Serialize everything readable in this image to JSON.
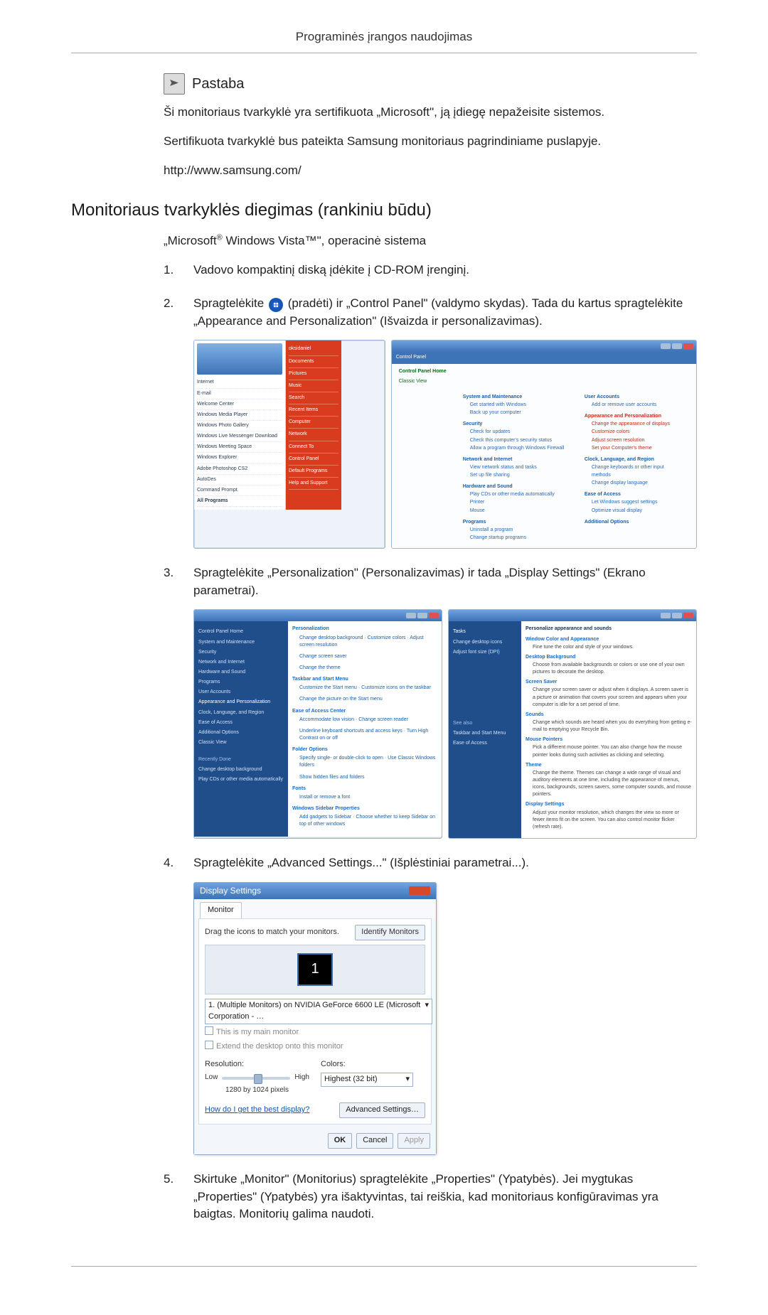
{
  "header": {
    "title": "Programinės įrangos naudojimas"
  },
  "note": {
    "icon_name": "note-icon",
    "title": "Pastaba",
    "lines": [
      "Ši monitoriaus tvarkyklė yra sertifikuota „Microsoft\", ją įdiegę nepažeisite sistemos.",
      "Sertifikuota tvarkyklė bus pateikta Samsung monitoriaus pagrindiniame puslapyje.",
      "http://www.samsung.com/"
    ]
  },
  "section": {
    "heading": "Monitoriaus tvarkyklės diegimas (rankiniu būdu)",
    "os_line_pre": "„Microsoft",
    "os_reg": "®",
    "os_line_post": " Windows Vista™\", operacinė sistema"
  },
  "steps": [
    {
      "text": "Vadovo kompaktinį diską įdėkite į CD-ROM įrenginį."
    },
    {
      "pre": "Spragtelėkite ",
      "icon_name": "start-icon",
      "post": "(pradėti) ir „Control Panel\" (valdymo skydas). Tada du kartus spragtelėkite „Appearance and Personalization\" (Išvaizda ir personalizavimas)."
    },
    {
      "text": "Spragtelėkite „Personalization\" (Personalizavimas) ir tada „Display Settings\" (Ekrano parametrai)."
    },
    {
      "text": "Spragtelėkite „Advanced Settings...\" (Išplėstiniai parametrai...)."
    },
    {
      "text": "Skirtuke „Monitor\" (Monitorius) spragtelėkite „Properties\" (Ypatybės). Jei mygtukas „Properties\" (Ypatybės) yra išaktyvintas, tai reiškia, kad monitoriaus konfigūravimas yra baigtas. Monitorių galima naudoti."
    }
  ],
  "shot_start": {
    "sidebar": [
      "Internet",
      "E-mail",
      "Welcome Center",
      "Windows Media Player",
      "Windows Photo Gallery",
      "Windows Live Messenger Download",
      "Windows Meeting Space",
      "Windows Explorer",
      "Adobe Photoshop CS2",
      "AutoDes",
      "Command Prompt"
    ],
    "sidebar_bottom": "All Programs",
    "right": [
      "oksidaniel",
      "Documents",
      "Pictures",
      "Music",
      "Search",
      "Recent Items",
      "Computer",
      "Network",
      "Connect To",
      "Control Panel",
      "Default Programs",
      "Help and Support"
    ]
  },
  "shot_cp": {
    "breadcrumb": "Control Panel",
    "home": "Control Panel Home",
    "classic": "Classic View",
    "left": [
      {
        "t": "System and Maintenance",
        "s": [
          "Get started with Windows",
          "Back up your computer"
        ]
      },
      {
        "t": "Security",
        "s": [
          "Check for updates",
          "Check this computer's security status",
          "Allow a program through Windows Firewall"
        ]
      },
      {
        "t": "Network and Internet",
        "s": [
          "View network status and tasks",
          "Set up file sharing"
        ]
      },
      {
        "t": "Hardware and Sound",
        "s": [
          "Play CDs or other media automatically",
          "Printer",
          "Mouse"
        ]
      },
      {
        "t": "Programs",
        "s": [
          "Uninstall a program",
          "Change startup programs"
        ]
      }
    ],
    "right": [
      {
        "t": "User Accounts",
        "s": [
          "Add or remove user accounts"
        ]
      },
      {
        "t": "Appearance and Personalization",
        "s": [
          "Change the appearance of displays",
          "Customize colors",
          "Adjust screen resolution",
          "Set your Computer's theme"
        ]
      },
      {
        "t": "Clock, Language, and Region",
        "s": [
          "Change keyboards or other input",
          "methods",
          "Change display language"
        ]
      },
      {
        "t": "Ease of Access",
        "s": [
          "Let Windows suggest settings",
          "Optimize visual display"
        ]
      },
      {
        "t": "Additional Options",
        "s": []
      }
    ]
  },
  "shot_perso_a": {
    "side": [
      "Control Panel Home",
      "System and Maintenance",
      "Security",
      "Network and Internet",
      "Hardware and Sound",
      "Programs",
      "User Accounts",
      "Appearance and Personalization",
      "Clock, Language, and Region",
      "Ease of Access",
      "Additional Options",
      "Classic View"
    ],
    "side_bottom": [
      "Recently Done",
      "Change desktop background",
      "Play CDs or other media automatically"
    ],
    "main": [
      {
        "t": "Personalization",
        "s": [
          "Change desktop background · Customize colors · Adjust screen resolution",
          "Change screen saver",
          "Change the theme"
        ]
      },
      {
        "t": "Taskbar and Start Menu",
        "s": [
          "Customize the Start menu · Customize icons on the taskbar",
          "Change the picture on the Start menu"
        ]
      },
      {
        "t": "Ease of Access Center",
        "s": [
          "Accommodate low vision · Change screen reader",
          "Underline keyboard shortcuts and access keys · Turn High Contrast on or off"
        ]
      },
      {
        "t": "Folder Options",
        "s": [
          "Specify single- or double-click to open · Use Classic Windows folders",
          "Show hidden files and folders"
        ]
      },
      {
        "t": "Fonts",
        "s": [
          "Install or remove a font"
        ]
      },
      {
        "t": "Windows Sidebar Properties",
        "s": [
          "Add gadgets to Sidebar · Choose whether to keep Sidebar on top of other windows"
        ]
      }
    ]
  },
  "shot_perso_b": {
    "side": [
      "Tasks",
      "Change desktop icons",
      "Adjust font size (DPI)"
    ],
    "title": "Personalize appearance and sounds",
    "main": [
      {
        "t": "Window Color and Appearance",
        "d": "Fine tune the color and style of your windows."
      },
      {
        "t": "Desktop Background",
        "d": "Choose from available backgrounds or colors or use one of your own pictures to decorate the desktop."
      },
      {
        "t": "Screen Saver",
        "d": "Change your screen saver or adjust when it displays. A screen saver is a picture or animation that covers your screen and appears when your computer is idle for a set period of time."
      },
      {
        "t": "Sounds",
        "d": "Change which sounds are heard when you do everything from getting e-mail to emptying your Recycle Bin."
      },
      {
        "t": "Mouse Pointers",
        "d": "Pick a different mouse pointer. You can also change how the mouse pointer looks during such activities as clicking and selecting."
      },
      {
        "t": "Theme",
        "d": "Change the theme. Themes can change a wide range of visual and auditory elements at one time, including the appearance of menus, icons, backgrounds, screen savers, some computer sounds, and mouse pointers."
      },
      {
        "t": "Display Settings",
        "d": "Adjust your monitor resolution, which changes the view so more or fewer items fit on the screen. You can also control monitor flicker (refresh rate)."
      }
    ],
    "bottom": [
      "See also",
      "Taskbar and Start Menu",
      "Ease of Access"
    ]
  },
  "dlg": {
    "title": "Display Settings",
    "tab": "Monitor",
    "drag": "Drag the icons to match your monitors.",
    "identify": "Identify Monitors",
    "mon_label": "1",
    "mon_sel": "1. (Multiple Monitors) on NVIDIA GeForce 6600 LE (Microsoft Corporation - …",
    "chk1": "This is my main monitor",
    "chk2": "Extend the desktop onto this monitor",
    "res_label": "Resolution:",
    "low": "Low",
    "high": "High",
    "res_val": "1280 by 1024 pixels",
    "col_label": "Colors:",
    "col_val": "Highest (32 bit)",
    "help": "How do I get the best display?",
    "adv": "Advanced Settings…",
    "ok": "OK",
    "cancel": "Cancel",
    "apply": "Apply"
  }
}
